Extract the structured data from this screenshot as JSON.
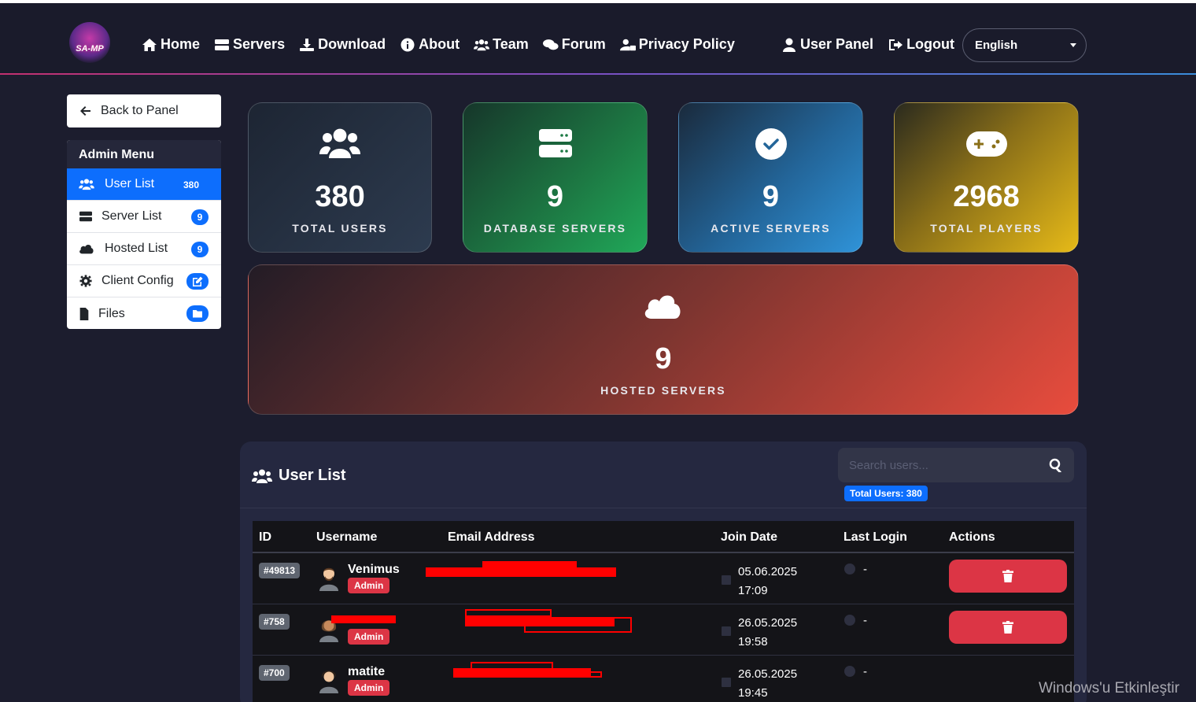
{
  "navbar": {
    "logo_text": "SA-MP",
    "links": [
      {
        "label": "Home",
        "icon": "home-icon"
      },
      {
        "label": "Servers",
        "icon": "server-icon"
      },
      {
        "label": "Download",
        "icon": "download-icon"
      },
      {
        "label": "About",
        "icon": "info-icon"
      },
      {
        "label": "Team",
        "icon": "users-icon"
      },
      {
        "label": "Forum",
        "icon": "comments-icon"
      },
      {
        "label": "Privacy Policy",
        "icon": "user-lock-icon"
      }
    ],
    "user_panel": "User Panel",
    "logout": "Logout",
    "language": "English"
  },
  "sidebar": {
    "back_label": "Back to Panel",
    "menu_title": "Admin Menu",
    "items": [
      {
        "label": "User List",
        "badge": "380",
        "icon": "users-icon"
      },
      {
        "label": "Server List",
        "badge": "9",
        "icon": "server-icon"
      },
      {
        "label": "Hosted List",
        "badge": "9",
        "icon": "cloud-icon"
      },
      {
        "label": "Client Config",
        "badge": "",
        "icon": "gear-icon"
      },
      {
        "label": "Files",
        "badge": "",
        "icon": "file-icon"
      }
    ]
  },
  "stats": {
    "users": {
      "value": "380",
      "label": "TOTAL USERS"
    },
    "db_servers": {
      "value": "9",
      "label": "DATABASE SERVERS"
    },
    "active_servers": {
      "value": "9",
      "label": "ACTIVE SERVERS"
    },
    "players": {
      "value": "2968",
      "label": "TOTAL PLAYERS"
    },
    "hosted": {
      "value": "9",
      "label": "HOSTED SERVERS"
    }
  },
  "user_list": {
    "title": "User List",
    "search_placeholder": "Search users...",
    "total_badge": "Total Users: 380",
    "columns": [
      "ID",
      "Username",
      "Email Address",
      "Join Date",
      "Last Login",
      "Actions"
    ],
    "rows": [
      {
        "id": "#49813",
        "username": "Venimus",
        "role": "Admin",
        "email": "",
        "join_date": "05.06.2025",
        "join_time": "17:09",
        "last_login": "-"
      },
      {
        "id": "#758",
        "username": "",
        "role": "Admin",
        "email": "",
        "join_date": "26.05.2025",
        "join_time": "19:58",
        "last_login": "-"
      },
      {
        "id": "#700",
        "username": "matite",
        "role": "Admin",
        "email": "",
        "join_date": "26.05.2025",
        "join_time": "19:45",
        "last_login": "-"
      }
    ]
  },
  "watermark": "Windows'u Etkinleştir",
  "colors": {
    "primary": "#0d6efd",
    "danger": "#dc3545",
    "background": "#1c1d2e",
    "panel": "#252840"
  }
}
